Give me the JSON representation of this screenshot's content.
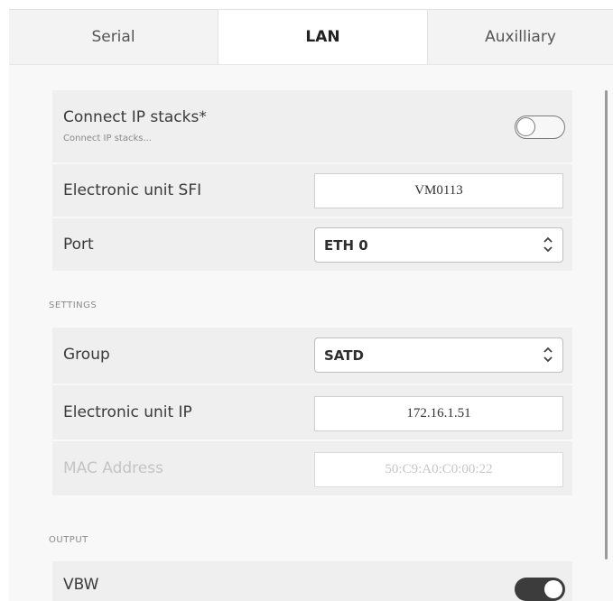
{
  "tabs": [
    {
      "label": "Serial",
      "active": false
    },
    {
      "label": "LAN",
      "active": true
    },
    {
      "label": "Auxilliary",
      "active": false
    }
  ],
  "connect": {
    "label": "Connect IP stacks*",
    "sublabel": "Connect IP stacks...",
    "toggle_on": false
  },
  "sfi": {
    "label": "Electronic unit SFI",
    "value": "VM0113"
  },
  "port": {
    "label": "Port",
    "value": "ETH 0"
  },
  "settings": {
    "section_title": "SETTINGS",
    "group": {
      "label": "Group",
      "value": "SATD"
    },
    "ip": {
      "label": "Electronic unit IP",
      "value": "172.16.1.51"
    },
    "mac": {
      "label": "MAC Address",
      "value": "50:C9:A0:C0:00:22",
      "disabled": true
    }
  },
  "output": {
    "section_title": "OUTPUT",
    "vbw": {
      "label": "VBW",
      "toggle_on": true
    }
  },
  "colors": {
    "accent": "#3c3c3c",
    "row_bg": "#efefef",
    "panel_bg": "#f8f8f8"
  }
}
